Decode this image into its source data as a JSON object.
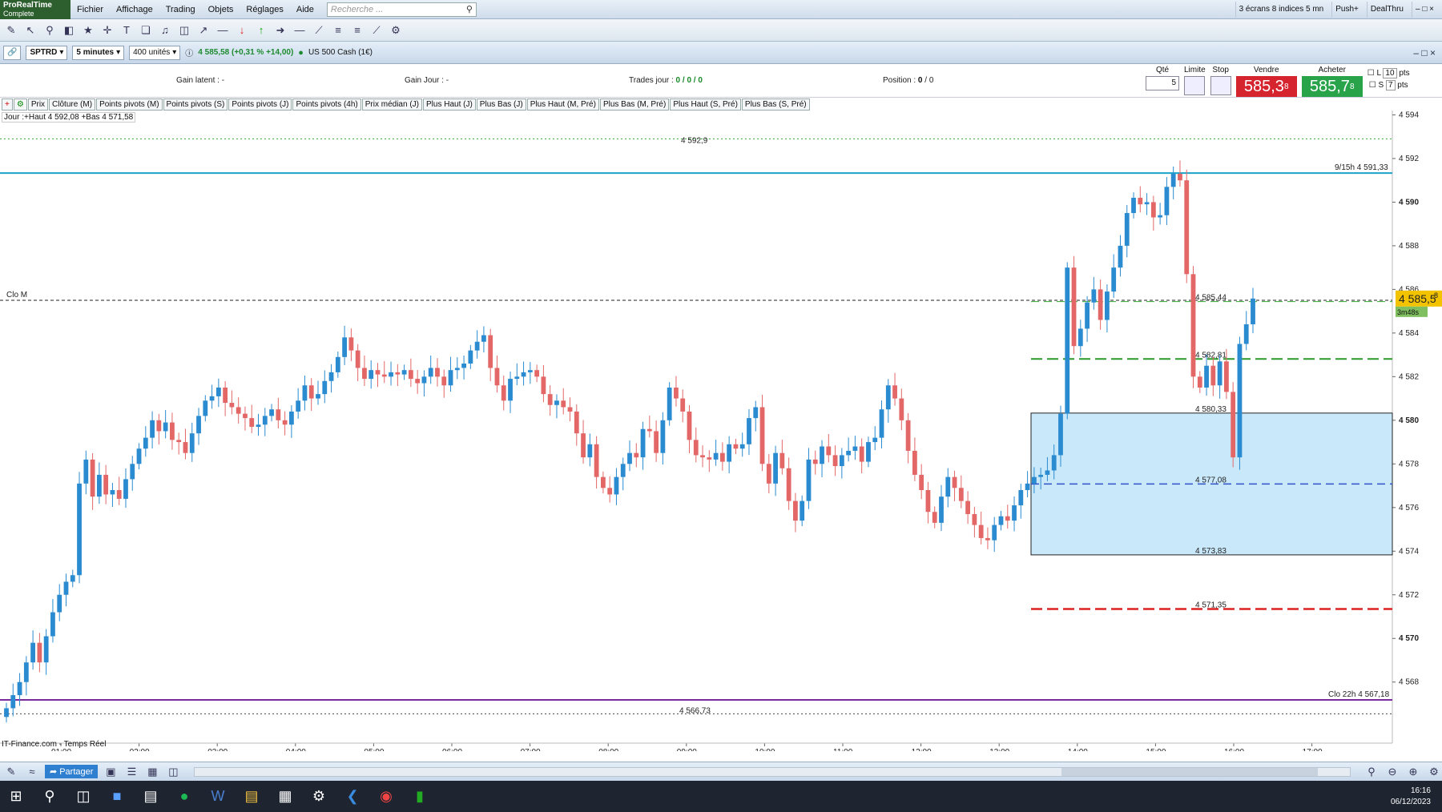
{
  "app": {
    "logo_line1": "ProRealTime",
    "logo_line2": "Complete"
  },
  "menu": {
    "items": [
      "Fichier",
      "Affichage",
      "Trading",
      "Objets",
      "Réglages",
      "Aide"
    ],
    "search_placeholder": "Recherche ..."
  },
  "menu_right": {
    "screens": "3 écrans 8 indices 5 mn",
    "push": "Push+",
    "dealthru": "DealThru"
  },
  "instrument": {
    "ticker": "SPTRD",
    "timeframe": "5 minutes",
    "units": "400 unités",
    "price_info": "4 585,58 (+0,31 % +14,00)",
    "name": "US 500 Cash (1€)"
  },
  "position_bar": {
    "gain_latent": "Gain latent :  -",
    "gain_jour": "Gain Jour :  -",
    "trades_label": "Trades jour : ",
    "trades_value": "0 / 0 / 0",
    "position_label": "Position : ",
    "position_value": "0",
    "position_extra": "/ 0"
  },
  "order_panel": {
    "qte_label": "Qté",
    "qte_value": "5",
    "limite_label": "Limite",
    "stop_label": "Stop",
    "sell_label": "Vendre",
    "buy_label": "Acheter",
    "sell_price": "585,3",
    "sell_sup": "8",
    "buy_price": "585,7",
    "buy_sup": "8",
    "l_label": "L",
    "l_value": "10",
    "s_label": "S",
    "s_value": "7",
    "pts": "pts"
  },
  "indicators": [
    "Prix",
    "Clôture (M)",
    "Points pivots (M)",
    "Points pivots (S)",
    "Points pivots (J)",
    "Points pivots (4h)",
    "Prix médian (J)",
    "Plus Haut (J)",
    "Plus Bas (J)",
    "Plus Haut (M, Pré)",
    "Plus Bas (M, Pré)",
    "Plus Haut (S, Pré)",
    "Plus Bas (S, Pré)"
  ],
  "chart_label": "Jour :+Haut 4 592,08 +Bas 4 571,58",
  "source_label": "IT-Finance.com - Temps Réel",
  "bottom": {
    "share": "Partager"
  },
  "clock": {
    "time": "16:16",
    "date": "06/12/2023"
  },
  "colors": {
    "up": "#2a8bd0",
    "down": "#e36767",
    "cyan_line": "#1aa3c8",
    "purple_line": "#7a2a9a",
    "zone": "#c9e9fb",
    "price_tag": "#f3c300"
  },
  "chart_data": {
    "type": "candlestick",
    "y_ticks": [
      4594,
      4592,
      4590,
      4588,
      4586,
      4584,
      4582,
      4580,
      4578,
      4576,
      4574,
      4572,
      4570,
      4568
    ],
    "y_tick_labels": [
      "4 594",
      "4 592",
      "4 590",
      "4 588",
      "4 586",
      "4 584",
      "4 582",
      "4 580",
      "4 578",
      "4 576",
      "4 574",
      "4 572",
      "4 570",
      "4 568"
    ],
    "ylim": [
      4565.2,
      4594.2
    ],
    "x_ticks": [
      "01:00",
      "02:00",
      "03:00",
      "04:00",
      "05:00",
      "06:00",
      "07:00",
      "08:00",
      "09:00",
      "10:00",
      "11:00",
      "12:00",
      "13:00",
      "14:00",
      "15:00",
      "16:00",
      "17:00"
    ],
    "h_lines": [
      {
        "value": 4592.9,
        "label": "4 592,9",
        "style": "dotted-green"
      },
      {
        "value": 4591.33,
        "label": "9/15h 4 591,33",
        "style": "cyan"
      },
      {
        "value": 4585.5,
        "label": "Clo M",
        "style": "dashed-black"
      },
      {
        "value": 4585.44,
        "label": "4 585,44",
        "style": "dashed-green-thin"
      },
      {
        "value": 4582.81,
        "label": "4 582,81",
        "style": "dashed-green"
      },
      {
        "value": 4580.33,
        "label": "4 580,33",
        "style": "box-top"
      },
      {
        "value": 4577.08,
        "label": "4 577,08",
        "style": "dashed-blue"
      },
      {
        "value": 4573.83,
        "label": "4 573,83",
        "style": "box-bottom"
      },
      {
        "value": 4571.35,
        "label": "4 571,35",
        "style": "dashed-red"
      },
      {
        "value": 4567.18,
        "label": "Clo 22h 4 567,18",
        "style": "purple"
      },
      {
        "value": 4566.73,
        "label": "4 566,73",
        "style": "dotted-black"
      }
    ],
    "current_price": {
      "value": 4585.58,
      "label": "4 585,5",
      "sup": "8",
      "timer": "3m48s"
    },
    "closes": [
      4566.8,
      4567.4,
      4568.0,
      4568.9,
      4569.8,
      4568.9,
      4570.1,
      4571.2,
      4572.0,
      4572.6,
      4572.9,
      4577.1,
      4578.2,
      4576.5,
      4577.5,
      4576.6,
      4576.8,
      4576.4,
      4577.3,
      4578.0,
      4578.7,
      4579.2,
      4580.0,
      4579.5,
      4579.9,
      4579.1,
      4579.0,
      4578.5,
      4579.4,
      4580.2,
      4580.9,
      4581.1,
      4581.5,
      4580.8,
      4580.6,
      4580.3,
      4580.1,
      4579.7,
      4579.8,
      4580.2,
      4580.5,
      4580.0,
      4579.8,
      4580.4,
      4580.9,
      4581.6,
      4581.0,
      4581.2,
      4581.8,
      4582.2,
      4582.9,
      4583.8,
      4583.2,
      4582.4,
      4581.9,
      4582.3,
      4582.1,
      4582.0,
      4582.2,
      4582.1,
      4582.3,
      4581.9,
      4581.7,
      4582.0,
      4582.4,
      4582.0,
      4581.6,
      4582.3,
      4582.4,
      4582.6,
      4583.2,
      4583.6,
      4583.9,
      4582.4,
      4581.6,
      4580.9,
      4581.9,
      4582.0,
      4582.2,
      4582.3,
      4582.0,
      4581.2,
      4580.7,
      4580.9,
      4580.6,
      4580.4,
      4579.4,
      4578.3,
      4578.9,
      4577.4,
      4576.9,
      4576.6,
      4577.4,
      4578.0,
      4578.5,
      4578.3,
      4579.6,
      4579.5,
      4578.5,
      4580.0,
      4581.5,
      4581.0,
      4580.4,
      4579.1,
      4578.4,
      4578.3,
      4578.2,
      4578.5,
      4578.1,
      4578.9,
      4578.7,
      4578.9,
      4580.1,
      4580.6,
      4578.0,
      4577.1,
      4578.5,
      4577.8,
      4576.3,
      4575.4,
      4576.3,
      4578.2,
      4578.0,
      4578.8,
      4578.4,
      4577.9,
      4578.4,
      4578.6,
      4578.8,
      4578.1,
      4579.0,
      4579.2,
      4580.5,
      4581.6,
      4581.0,
      4580.0,
      4578.6,
      4577.5,
      4576.8,
      4575.8,
      4575.3,
      4576.5,
      4577.4,
      4576.9,
      4576.3,
      4575.7,
      4575.2,
      4574.6,
      4574.5,
      4575.2,
      4575.6,
      4575.4,
      4576.1,
      4576.8,
      4577.1,
      4577.4,
      4577.5,
      4577.7,
      4578.4,
      4580.3,
      4587.0,
      4583.4,
      4584.2,
      4585.4,
      4586.0,
      4584.6,
      4585.9,
      4587.0,
      4588.0,
      4589.5,
      4590.2,
      4589.9,
      4590.0,
      4589.3,
      4589.4,
      4590.7,
      4591.3,
      4591.0,
      4586.7,
      4582.0,
      4581.5,
      4582.5,
      4581.6,
      4582.7,
      4581.3,
      4578.3,
      4583.5,
      4584.4,
      4585.58
    ]
  }
}
